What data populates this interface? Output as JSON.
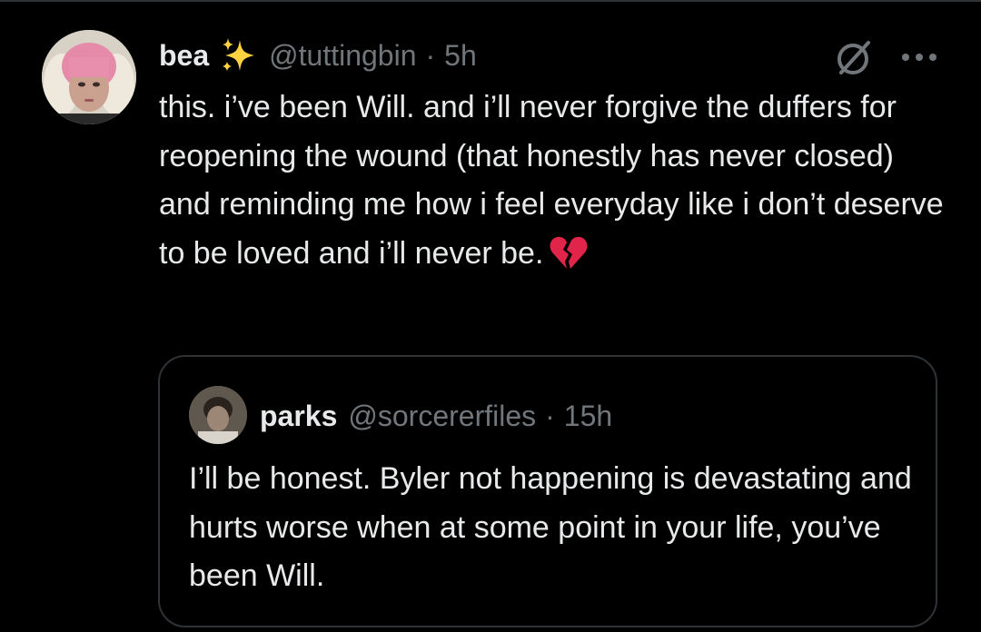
{
  "post": {
    "author": {
      "display_name": "bea",
      "name_badge_icon": "sparkles-icon",
      "handle": "@tuttingbin",
      "separator": "·",
      "time": "5h"
    },
    "text": "this. i’ve been Will. and i’ll never forgive the duffers for reopening the wound (that honestly has never closed) and reminding me how i feel everyday like i don’t deserve to be loved and i’ll never be.",
    "emoji_icon": "broken-heart-icon",
    "action_icons": [
      "grok-icon",
      "more-icon"
    ]
  },
  "quoted_post": {
    "author": {
      "display_name": "parks",
      "handle": "@sorcererfiles",
      "separator": "·",
      "time": "15h"
    },
    "text": "I’ll be honest. Byler not happening is devastating and hurts worse when at some point in your life, you’ve been Will."
  },
  "colors": {
    "background": "#000000",
    "text_primary": "#e7e9ea",
    "text_secondary": "#71767b",
    "border": "#2f3336",
    "sparkle": "#ffd23f",
    "broken_heart": "#e0244a"
  }
}
